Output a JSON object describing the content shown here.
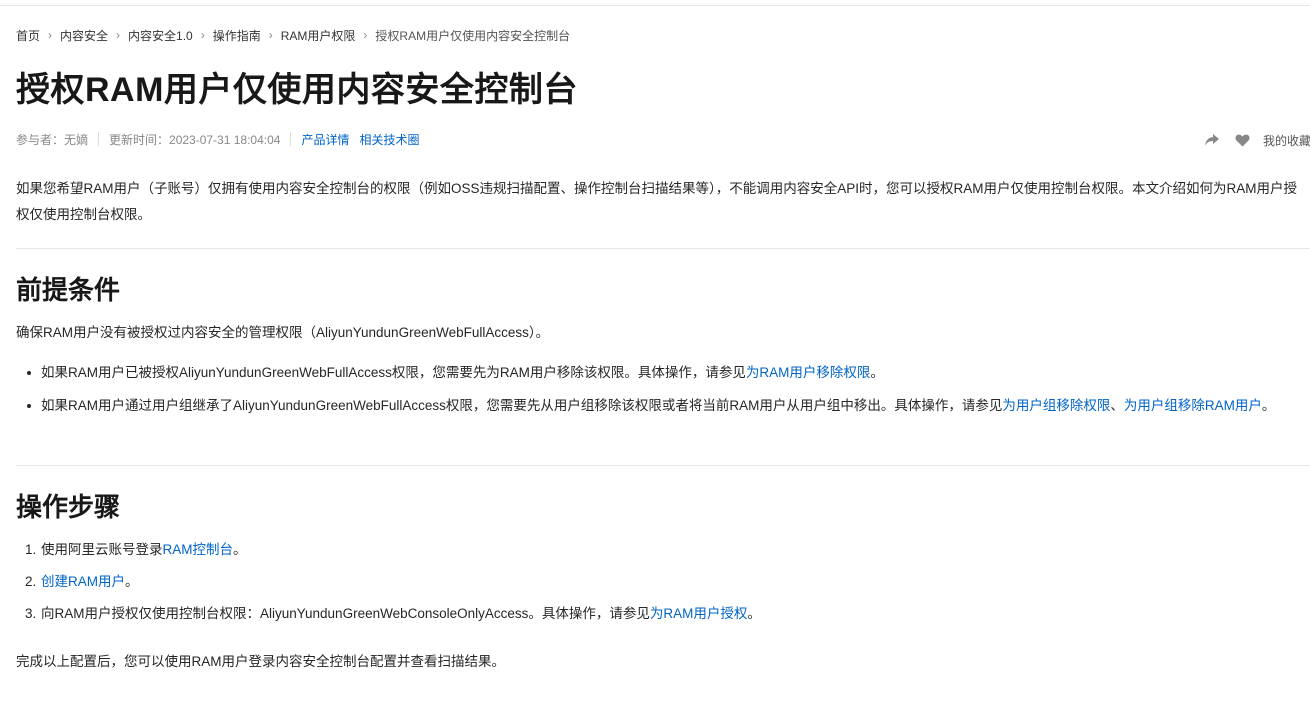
{
  "breadcrumb": {
    "items": [
      "首页",
      "内容安全",
      "内容安全1.0",
      "操作指南",
      "RAM用户权限"
    ],
    "current": "授权RAM用户仅使用内容安全控制台"
  },
  "page": {
    "title": "授权RAM用户仅使用内容安全控制台"
  },
  "meta": {
    "contributors": "参与者：无嫡",
    "updated": "更新时间：2023-07-31 18:04:04",
    "product_link": "产品详情",
    "circle_link": "相关技术圈"
  },
  "actions": {
    "share_icon": "share-icon",
    "like_icon": "heart-icon",
    "favorites_label": "我的收藏"
  },
  "intro": {
    "text": "如果您希望RAM用户（子账号）仅拥有使用内容安全控制台的权限（例如OSS违规扫描配置、操作控制台扫描结果等），不能调用内容安全API时，您可以授权RAM用户仅使用控制台权限。本文介绍如何为RAM用户授权仅使用控制台权限。"
  },
  "prereq": {
    "heading": "前提条件",
    "text": "确保RAM用户没有被授权过内容安全的管理权限（AliyunYundunGreenWebFullAccess）。",
    "bullets": [
      {
        "text": "如果RAM用户已被授权AliyunYundunGreenWebFullAccess权限，您需要先为RAM用户移除该权限。具体操作，请参见",
        "link": "为RAM用户移除权限",
        "end": "。"
      },
      {
        "text": "如果RAM用户通过用户组继承了AliyunYundunGreenWebFullAccess权限，您需要先从用户组移除该权限或者将当前RAM用户从用户组中移出。具体操作，请参见",
        "link1": "为用户组移除权限",
        "sep": "、",
        "link2": "为用户组移除RAM用户",
        "end": "。"
      }
    ]
  },
  "steps": {
    "heading": "操作步骤",
    "items": [
      {
        "num": "1.",
        "text": "使用阿里云账号登录",
        "link": "RAM控制台",
        "end": "。"
      },
      {
        "num": "2.",
        "text": "",
        "link": "创建RAM用户",
        "end": "。"
      },
      {
        "num": "3.",
        "text": "向RAM用户授权仅使用控制台权限：AliyunYundunGreenWebConsoleOnlyAccess。具体操作，请参见",
        "link": "为RAM用户授权",
        "end": "。"
      }
    ],
    "conclusion": "完成以上配置后，您可以使用RAM用户登录内容安全控制台配置并查看扫描结果。"
  }
}
